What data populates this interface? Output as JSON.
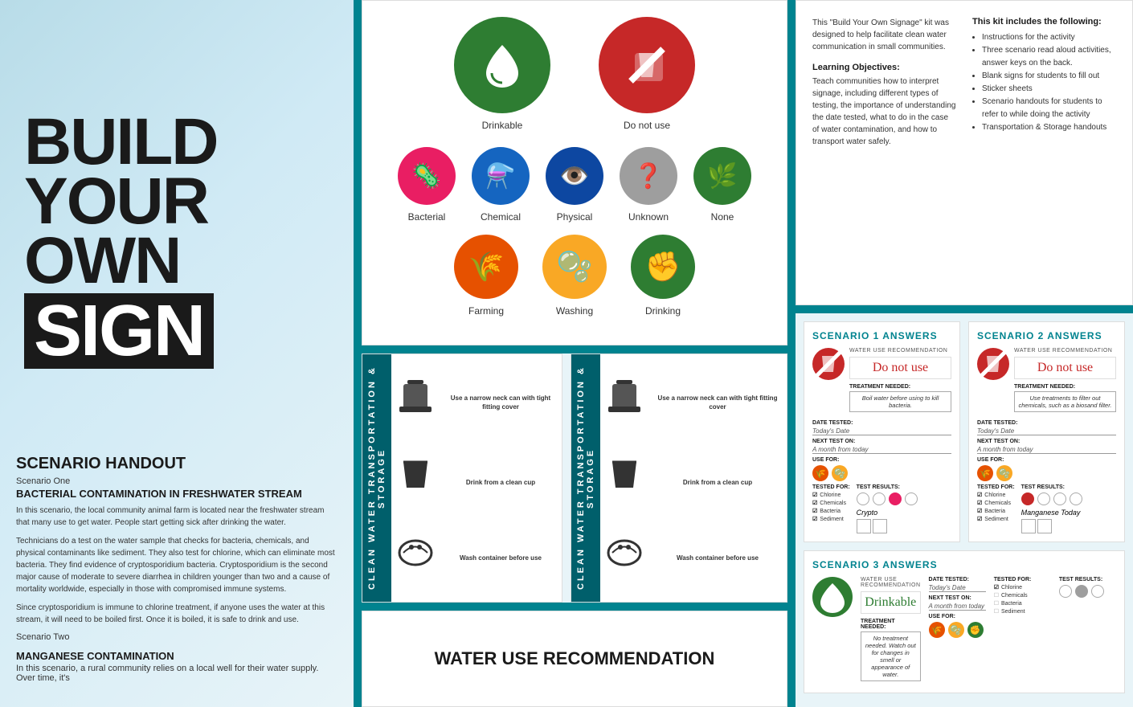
{
  "title": {
    "line1": "BUILD",
    "line2": "YOUR",
    "line3": "OWN",
    "line4": "SIGN"
  },
  "kit": {
    "description": "This \"Build Your Own Signage\" kit was designed to help facilitate clean water communication in small communities.",
    "learning_objectives_title": "Learning Objectives:",
    "learning_objectives_text": "Teach communities how to interpret signage, including different types of testing, the importance of understanding the date tested, what to do in the case of water contamination, and how to transport water safely.",
    "includes_title": "This kit includes the following:",
    "includes_items": [
      "Instructions for the activity",
      "Three scenario read aloud activities, answer keys on the back.",
      "Blank signs for students to fill out",
      "Sticker sheets",
      "Scenario handouts for students to refer to while doing the activity",
      "Transportation & Storage handouts"
    ]
  },
  "icons": {
    "drinkable_label": "Drinkable",
    "do_not_use_label": "Do not use",
    "bacterial_label": "Bacterial",
    "chemical_label": "Chemical",
    "physical_label": "Physical",
    "unknown_label": "Unknown",
    "none_label": "None",
    "farming_label": "Farming",
    "washing_label": "Washing",
    "drinking_label": "Drinking"
  },
  "scenario_handout": {
    "title": "SCENARIO HANDOUT",
    "scenario_one_label": "Scenario One",
    "scenario_one_title": "BACTERIAL CONTAMINATION IN FRESHWATER STREAM",
    "scenario_one_text1": "In this scenario, the local community animal farm is located near the freshwater stream that many use to get water. People start getting sick after drinking the water.",
    "scenario_one_text2": "Technicians do a test on the water sample that checks for bacteria, chemicals, and physical contaminants like sediment. They also test for chlorine, which can eliminate most bacteria. They find evidence of cryptosporidium bacteria. Cryptosporidium is the second major cause of moderate to severe diarrhea in children younger than two and a cause of mortality worldwide, especially in those with compromised immune systems.",
    "scenario_one_text3": "Since cryptosporidium is immune to chlorine treatment, if anyone uses the water at this stream, it will need to be boiled first. Once it is boiled, it is safe to drink and use.",
    "scenario_two_label": "Scenario Two",
    "scenario_two_title": "MANGANESE CONTAMINATION",
    "scenario_two_text": "In this scenario, a rural community relies on a local well for their water supply. Over time, it's"
  },
  "transport": {
    "header": "CLEAN WATER TRANSPORTATION & STORAGE",
    "item1_icon": "🫙",
    "item1_text": "Use a narrow neck can with tight fitting cover",
    "item2_icon": "🫗",
    "item2_text": "Drink from a clean cup",
    "item3_icon": "🧼",
    "item3_text": "Wash container before use"
  },
  "water_recommendation": {
    "title": "WATER USE RECOMMENDATION"
  },
  "scenario_answers": {
    "scenario1_title": "SCENARIO 1 ANSWERS",
    "scenario2_title": "SCENARIO 2 ANSWERS",
    "scenario3_title": "SCENARIO 3 ANSWERS",
    "recommendation_label": "WATER USE RECOMMENDATION",
    "do_not_use": "Do not use",
    "drinkable": "Drinkable",
    "treatment_label": "TREATMENT NEEDED:",
    "s1_treatment": "Boil water before using to kill bacteria.",
    "s2_treatment": "Use treatments to filter out chemicals, such as a biosand filter.",
    "s3_treatment": "No treatment needed. Watch out for changes in smell or appearance of water.",
    "date_tested_label": "DATE TESTED:",
    "date_value": "Today's Date",
    "next_test_label": "NEXT TEST ON:",
    "next_test_value": "A month from today",
    "use_for_label": "USE FOR:",
    "tested_for_label": "TESTED FOR:",
    "test_results_label": "TEST RESULTS:",
    "s1_checked": [
      "Chlorine",
      "Chemicals",
      "Bacteria",
      "Sediment"
    ],
    "s2_checked": [
      "Chlorine",
      "Chemicals",
      "Bacteria",
      "Sediment"
    ],
    "s3_checked": [
      "Chlorine",
      "Chemicals",
      "Bacteria"
    ],
    "s3_unchecked": [
      "Sediment"
    ],
    "s1_test_result_text": "Crypto",
    "s2_test_result_text": "Manganese Today"
  }
}
